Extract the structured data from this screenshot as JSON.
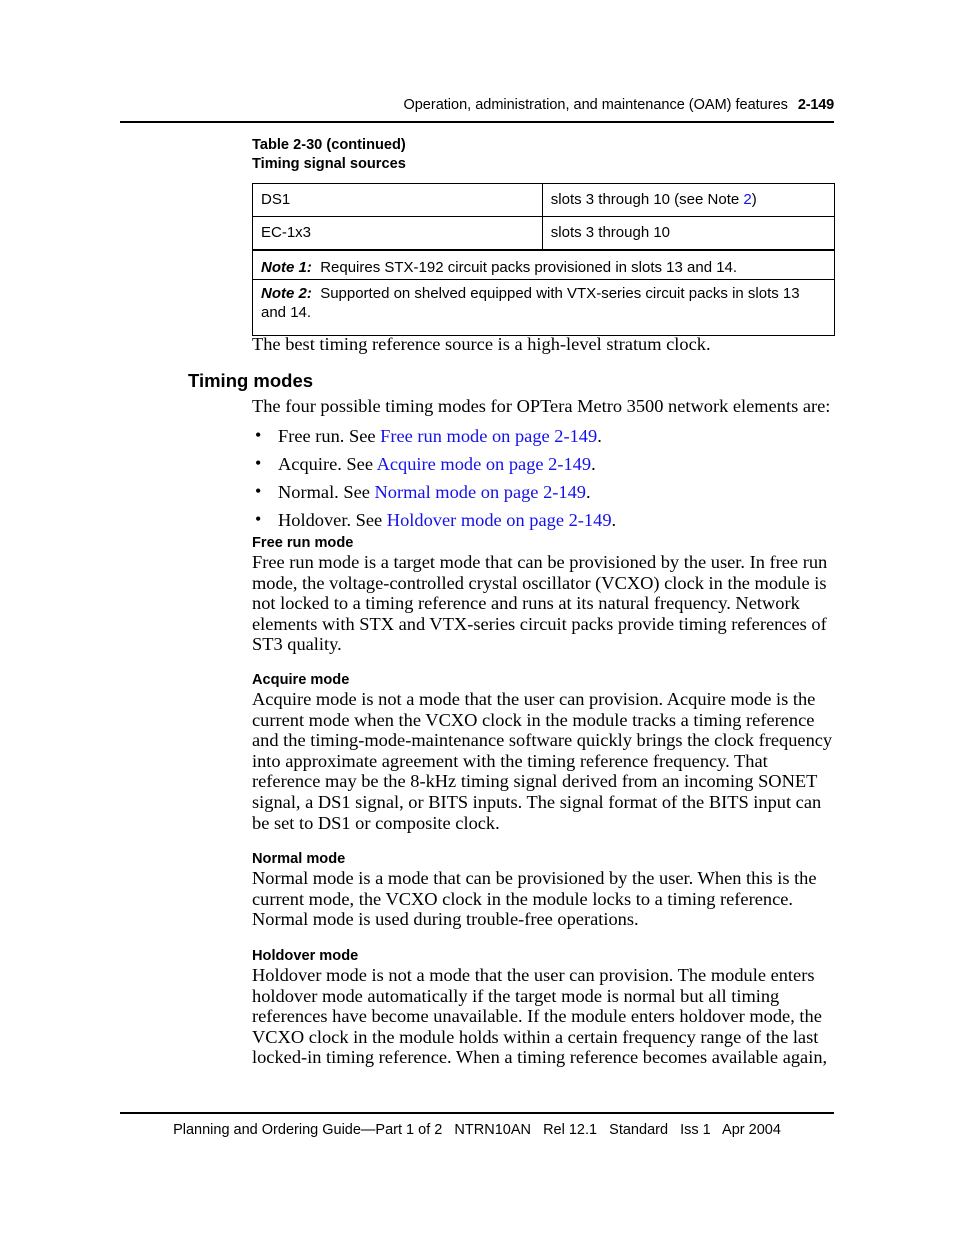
{
  "header": {
    "title": "Operation, administration, and maintenance (OAM) features",
    "page_number": "2-149"
  },
  "table": {
    "caption_line1": "Table 2-30 (continued)",
    "caption_line2": "Timing signal sources",
    "rows": [
      {
        "source": "DS1",
        "slots_prefix": "slots 3 through 10 (see Note ",
        "slots_link": "2",
        "slots_suffix": ")"
      },
      {
        "source": "EC-1x3",
        "slots_prefix": "slots 3 through 10",
        "slots_link": "",
        "slots_suffix": ""
      }
    ],
    "notes": [
      {
        "label": "Note 1:",
        "text": "Requires STX-192 circuit packs provisioned in slots 13 and 14."
      },
      {
        "label": "Note 2:",
        "text": "Supported on shelved equipped with VTX-series circuit packs in slots 13 and 14."
      }
    ]
  },
  "main": {
    "intro_paragraph": "The best timing reference source is a high-level stratum clock.",
    "section_heading": "Timing modes",
    "modes_intro": "The four possible timing modes for OPTera Metro 3500 network elements are:",
    "bullets": [
      {
        "lead": "Free run. See ",
        "link": "Free run mode on page 2-149",
        "tail": "."
      },
      {
        "lead": "Acquire. See ",
        "link": "Acquire mode on page 2-149",
        "tail": "."
      },
      {
        "lead": "Normal. See ",
        "link": "Normal mode on page 2-149",
        "tail": "."
      },
      {
        "lead": "Holdover. See ",
        "link": "Holdover mode on page 2-149",
        "tail": "."
      }
    ],
    "subsections": [
      {
        "heading": "Free run mode",
        "body": "Free run mode is a target mode that can be provisioned by the user. In free run mode, the voltage-controlled crystal oscillator (VCXO) clock in the module is not locked to a timing reference and runs at its natural frequency. Network elements with STX and VTX-series circuit packs provide timing references of ST3 quality."
      },
      {
        "heading": "Acquire mode",
        "body": "Acquire mode is not a mode that the user can provision. Acquire mode is the current mode when the VCXO clock in the module tracks a timing reference and the timing-mode-maintenance software quickly brings the clock frequency into approximate agreement with the timing reference frequency. That reference may be the 8-kHz timing signal derived from an incoming SONET signal, a DS1 signal, or BITS inputs. The signal format of the BITS input can be set to DS1 or composite clock."
      },
      {
        "heading": "Normal mode",
        "body": "Normal mode is a mode that can be provisioned by the user. When this is the current mode, the VCXO clock in the module locks to a timing reference. Normal mode is used during trouble-free operations."
      },
      {
        "heading": "Holdover mode",
        "body": "Holdover mode is not a mode that the user can provision. The module enters holdover mode automatically if the target mode is normal but all timing references have become unavailable. If the module enters holdover mode, the VCXO clock in the module holds within a certain frequency range of the last locked-in timing reference. When a timing reference becomes available again,"
      }
    ]
  },
  "footer": {
    "guide": "Planning and Ordering Guide—Part 1 of 2",
    "doc_number": "NTRN10AN",
    "release": "Rel 12.1",
    "status": "Standard",
    "issue": "Iss 1",
    "date": "Apr 2004"
  },
  "colors": {
    "link": "#1512e8",
    "text": "#000000"
  }
}
